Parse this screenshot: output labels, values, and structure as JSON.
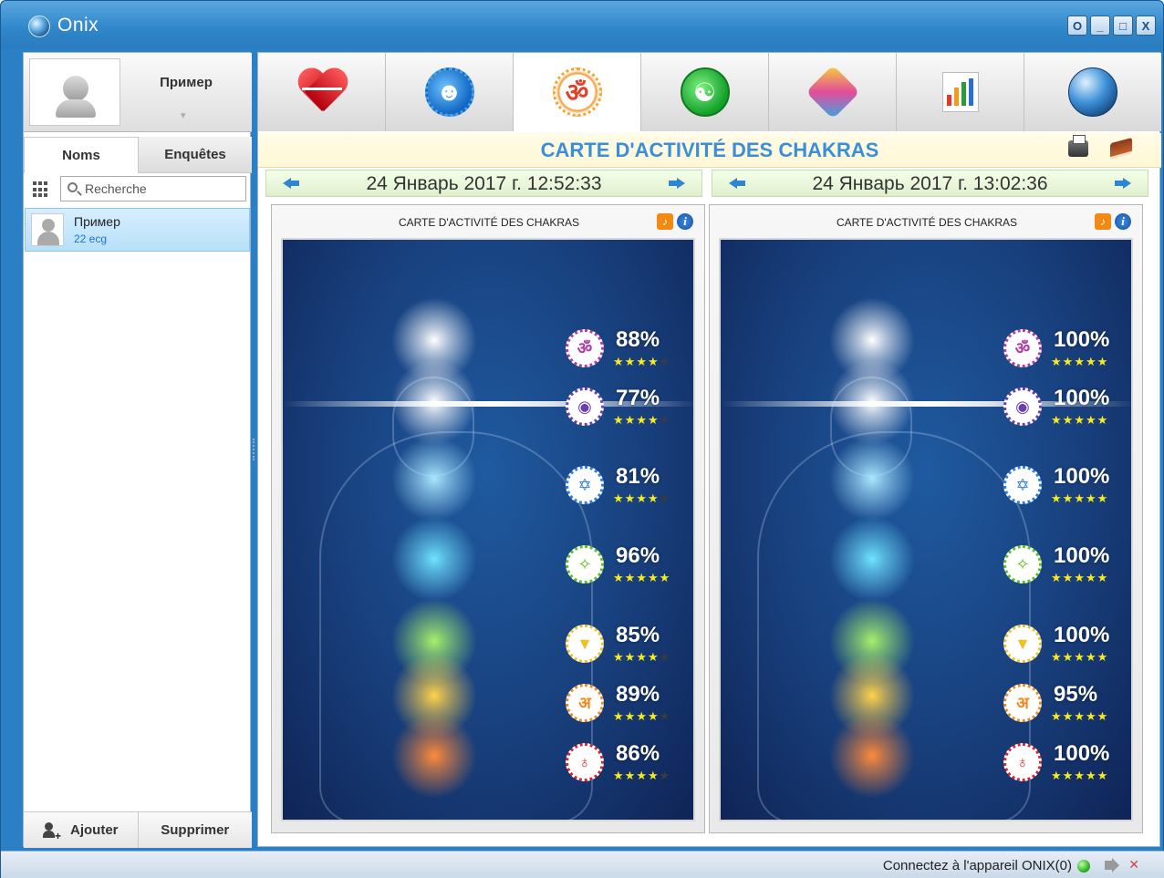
{
  "window": {
    "title": "Onix",
    "buttons": [
      "O",
      "_",
      "□",
      "X"
    ]
  },
  "profile": {
    "name": "Пример"
  },
  "left_tabs": [
    {
      "label": "Noms",
      "active": true
    },
    {
      "label": "Enquêtes",
      "active": false
    }
  ],
  "search": {
    "placeholder": "Recherche"
  },
  "people": [
    {
      "name": "Пример",
      "subtitle": "22 ecg",
      "selected": true
    }
  ],
  "left_actions": {
    "add": "Ajouter",
    "delete": "Supprimer"
  },
  "modules": [
    {
      "icon": "heart-ecg-icon"
    },
    {
      "icon": "head-profile-icon"
    },
    {
      "icon": "om-chakra-icon",
      "active": true
    },
    {
      "icon": "yin-yang-icon"
    },
    {
      "icon": "pentagon-diagram-icon"
    },
    {
      "icon": "bar-chart-icon"
    },
    {
      "icon": "globe-icon"
    }
  ],
  "page": {
    "title": "CARTE D'ACTIVITÉ DES CHAKRAS"
  },
  "panels": [
    {
      "date": "24 Январь 2017 г. 12:52:33",
      "label": "CARTE D'ACTIVITÉ DES CHAKRAS",
      "chakras": [
        {
          "percent": "88%",
          "stars": 4
        },
        {
          "percent": "77%",
          "stars": 4
        },
        {
          "percent": "81%",
          "stars": 4
        },
        {
          "percent": "96%",
          "stars": 5
        },
        {
          "percent": "85%",
          "stars": 4
        },
        {
          "percent": "89%",
          "stars": 4
        },
        {
          "percent": "86%",
          "stars": 4
        }
      ]
    },
    {
      "date": "24 Январь 2017 г. 13:02:36",
      "label": "CARTE D'ACTIVITÉ DES CHAKRAS",
      "chakras": [
        {
          "percent": "100%",
          "stars": 5
        },
        {
          "percent": "100%",
          "stars": 5
        },
        {
          "percent": "100%",
          "stars": 5
        },
        {
          "percent": "100%",
          "stars": 5
        },
        {
          "percent": "100%",
          "stars": 5
        },
        {
          "percent": "95%",
          "stars": 5
        },
        {
          "percent": "100%",
          "stars": 5
        }
      ]
    }
  ],
  "chakra_colors": [
    "#b33aa6",
    "#6a3fb0",
    "#2f7fd6",
    "#5fbf1f",
    "#f0c020",
    "#f08a1e",
    "#d8252d"
  ],
  "status": {
    "text": "Connectez à l'appareil ONIX(0)",
    "connected_color": "#22a51a"
  }
}
